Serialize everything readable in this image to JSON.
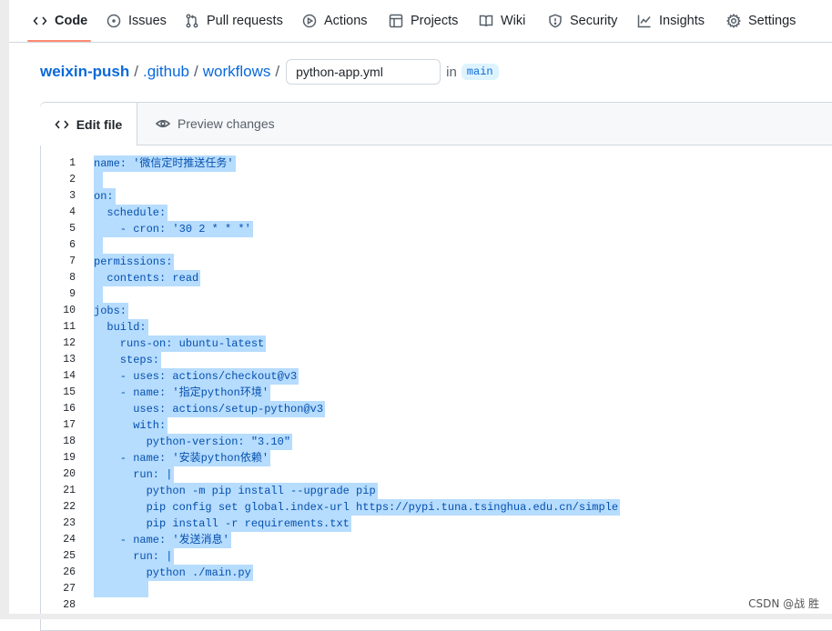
{
  "nav": {
    "code": "Code",
    "issues": "Issues",
    "pulls": "Pull requests",
    "actions": "Actions",
    "projects": "Projects",
    "wiki": "Wiki",
    "security": "Security",
    "insights": "Insights",
    "settings": "Settings"
  },
  "breadcrumb": {
    "repo": "weixin-push",
    "dir1": ".github",
    "dir2": "workflows",
    "sep": "/",
    "filename": "python-app.yml",
    "in_label": "in",
    "branch": "main"
  },
  "tabs": {
    "edit": "Edit file",
    "preview": "Preview changes"
  },
  "code_lines": [
    {
      "n": "1",
      "text": "name: '微信定时推送任务'"
    },
    {
      "n": "2",
      "text": ""
    },
    {
      "n": "3",
      "text": "on:"
    },
    {
      "n": "4",
      "text": "  schedule:"
    },
    {
      "n": "5",
      "text": "    - cron: '30 2 * * *'"
    },
    {
      "n": "6",
      "text": ""
    },
    {
      "n": "7",
      "text": "permissions:"
    },
    {
      "n": "8",
      "text": "  contents: read"
    },
    {
      "n": "9",
      "text": ""
    },
    {
      "n": "10",
      "text": "jobs:"
    },
    {
      "n": "11",
      "text": "  build:"
    },
    {
      "n": "12",
      "text": "    runs-on: ubuntu-latest"
    },
    {
      "n": "13",
      "text": "    steps:"
    },
    {
      "n": "14",
      "text": "    - uses: actions/checkout@v3"
    },
    {
      "n": "15",
      "text": "    - name: '指定python环境'"
    },
    {
      "n": "16",
      "text": "      uses: actions/setup-python@v3"
    },
    {
      "n": "17",
      "text": "      with:"
    },
    {
      "n": "18",
      "text": "        python-version: \"3.10\""
    },
    {
      "n": "19",
      "text": "    - name: '安装python依赖'"
    },
    {
      "n": "20",
      "text": "      run: |"
    },
    {
      "n": "21",
      "text": "        python -m pip install --upgrade pip"
    },
    {
      "n": "22",
      "text": "        pip config set global.index-url https://pypi.tuna.tsinghua.edu.cn/simple"
    },
    {
      "n": "23",
      "text": "        pip install -r requirements.txt"
    },
    {
      "n": "24",
      "text": "    - name: '发送消息'"
    },
    {
      "n": "25",
      "text": "      run: |"
    },
    {
      "n": "26",
      "text": "        python ./main.py"
    },
    {
      "n": "27",
      "text": ""
    },
    {
      "n": "28",
      "text": ""
    }
  ],
  "watermark": "CSDN @战 胜",
  "colors": {
    "link": "#0969da",
    "selection": "#b6dcfe",
    "nav_underline": "#fd8c73",
    "yaml_key": "#0550ae"
  }
}
